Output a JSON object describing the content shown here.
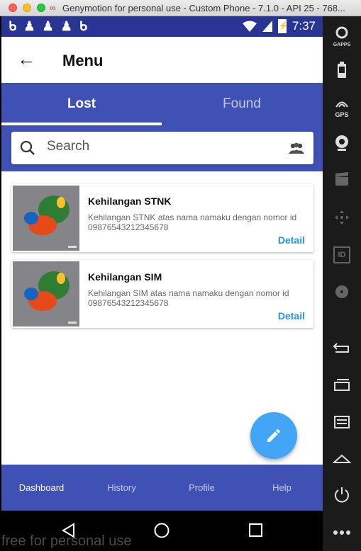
{
  "window": {
    "title": "Genymotion for personal use - Custom Phone - 7.1.0 - API 25 - 768..."
  },
  "statusbar": {
    "time": "7:37",
    "battery": "⚡"
  },
  "appbar": {
    "title": "Menu"
  },
  "tabs": [
    {
      "label": "Lost"
    },
    {
      "label": "Found"
    }
  ],
  "search": {
    "placeholder": "Search"
  },
  "cards": [
    {
      "title": "Kehilangan STNK",
      "description": "Kehilangan STNK atas nama namaku dengan nomor id 09876543212345678",
      "action": "Detail"
    },
    {
      "title": "Kehilangan SIM",
      "description": "Kehilangan SIM atas nama namaku dengan nomor id 09876543212345678",
      "action": "Detail"
    }
  ],
  "bottom_nav": [
    {
      "label": "Dashboard"
    },
    {
      "label": "History"
    },
    {
      "label": "Profile"
    },
    {
      "label": "Help"
    }
  ],
  "sidebar": {
    "gaps_label": "GAPPS",
    "gps_label": "GPS",
    "id_label": "ID"
  },
  "watermark": "free for personal use",
  "colors": {
    "primary": "#3f51b5",
    "statusbar": "#283593",
    "accent": "#2196f3",
    "fab": "#42a5f5"
  }
}
